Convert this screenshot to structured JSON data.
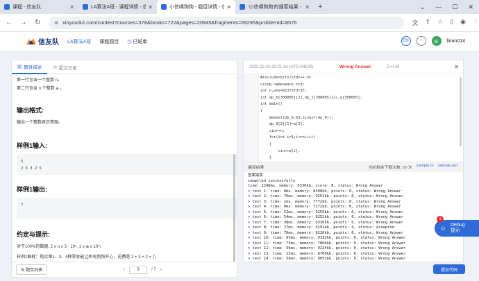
{
  "browser": {
    "tabs": [
      {
        "title": "课程 - 信友队",
        "color": "#2e6bd8"
      },
      {
        "title": "LA算法A班 - 课程详情 - 信友队",
        "color": "#2e6bd8"
      },
      {
        "title": "小信嗅狗狗 - 题目详情 - 信友队",
        "color": "#2e6bd8",
        "active": true
      },
      {
        "title": "'小信嗅狗狗'的搜索结果 - 信友队",
        "color": "#2e6bd8"
      }
    ],
    "url": "xinyouduì.com/contest?courses=378&books=722&pages=20945&fragments=69295&problemId=8576"
  },
  "site": {
    "logo": "信友队",
    "class_name": "LA算法A班",
    "nav_course": "课程题目",
    "nav_finished": "已结束",
    "lang_btn": "EN",
    "user_initial": "栎",
    "username": "linan014"
  },
  "left": {
    "tab_desc": "题目描述",
    "tab_submit": "提交记录",
    "line1": "第一行包含一个整数 n。",
    "line2": "第二行包含 n 个整数 aᵢ 。",
    "output_title": "输出格式:",
    "output_desc": "输出一个整数表示答案。",
    "sample_in_title": "样例1输入:",
    "sample_in_l1": "5",
    "sample_in_l2": "2 5 3 2 5",
    "sample_out_title": "样例1输出:",
    "sample_out_l1": "7",
    "hint_title": "约定与提示:",
    "hint_l1": "对于100%的数据, 2 ≤ n ≤ 3 · 10⁵, 1 ≤ aᵢ ≤ 10⁹。",
    "hint_l2": "样例1解释：购买第1、3、4种零食能让所有狗狗开心，花费是 2 + 3 + 2 = 7。",
    "list_btn": "题目列表",
    "page_current": "3",
    "page_total": "/ 7"
  },
  "right": {
    "timestamp": "2023-12-20 22:21:34 (UTC+08:00)",
    "status": "Wrong Answer",
    "lang": "C++14",
    "code": [
      "#include<bits/stdc++.h>",
      "using namespace std;",
      "int n,ans=0x3f3f3f3f;",
      "int dp_0[300005][2],dp_1[300005][2],a[300005];",
      "int main()",
      "{",
      "    memset(dp_0,63,sizeof(dp_0));",
      "    dp_0[2][1]=a[2];",
      "    cin>>n;",
      "    for(int i=1;i<=n;i++)",
      "    {",
      "        cin>>a[i];",
      "    }",
      "    for(int i=3;i<=n;i++)"
    ],
    "panel_label": "编译结果",
    "downloads": "当前剩余下载次数:  20 次",
    "link_in": "sample.in",
    "link_out": "sample.out",
    "result_lines": [
      "答案错误",
      "compiled successfully",
      "time: 1240ms, memory: 9336kb, score: 8, status: Wrong Answer",
      "> test 1: time: 0ms, memory: 8308kb, points: 0, status: Wrong Answer",
      "> test 2: time: 76ms, memory: 9252kb, points: 0, status: Wrong Answer",
      "> test 3: time: 1ms, memory: 7772kb, points: 0, status: Wrong Answer",
      "> test 4: time: 0ms, memory: 7272kb, points: 0, status: Wrong Answer",
      "> test 5: time: 52ms, memory: 9256kb, points: 0, status: Wrong Answer",
      "> test 6: time: 54ms, memory: 9252kb, points: 0, status: Wrong Answer",
      "> test 7: time: 38ms, memory: 9336kb, points: 0, status: Wrong Answer",
      "> test 8: time: 27ms, memory: 9292kb, points: 4, status: Accepted",
      "> test 9: time: 76ms, memory: 9220kb, points: 0, status: Wrong Answer",
      "> test 10: time: 65ms, memory: 9332kb, points: 0, status: Wrong Answer",
      "> test 11: time: 75ms, memory: 7860kb, points: 0, status: Wrong Answer",
      "> test 12: time: 56ms, memory: 9224kb, points: 0, status: Wrong Answer",
      "> test 13: time: 25ms, memory: 8700kb, points: 0, status: Wrong Answer",
      "> test 14: time: 58ms, memory: 9052kb, points: 0, status: Wrong Answer",
      "> test 15: time: 70ms, memory: 9308kb, points: 0, status: Wrong Answer"
    ],
    "debug_label": "Debug\n提示",
    "debug_badge": "1",
    "submit_label": "提交代码"
  }
}
